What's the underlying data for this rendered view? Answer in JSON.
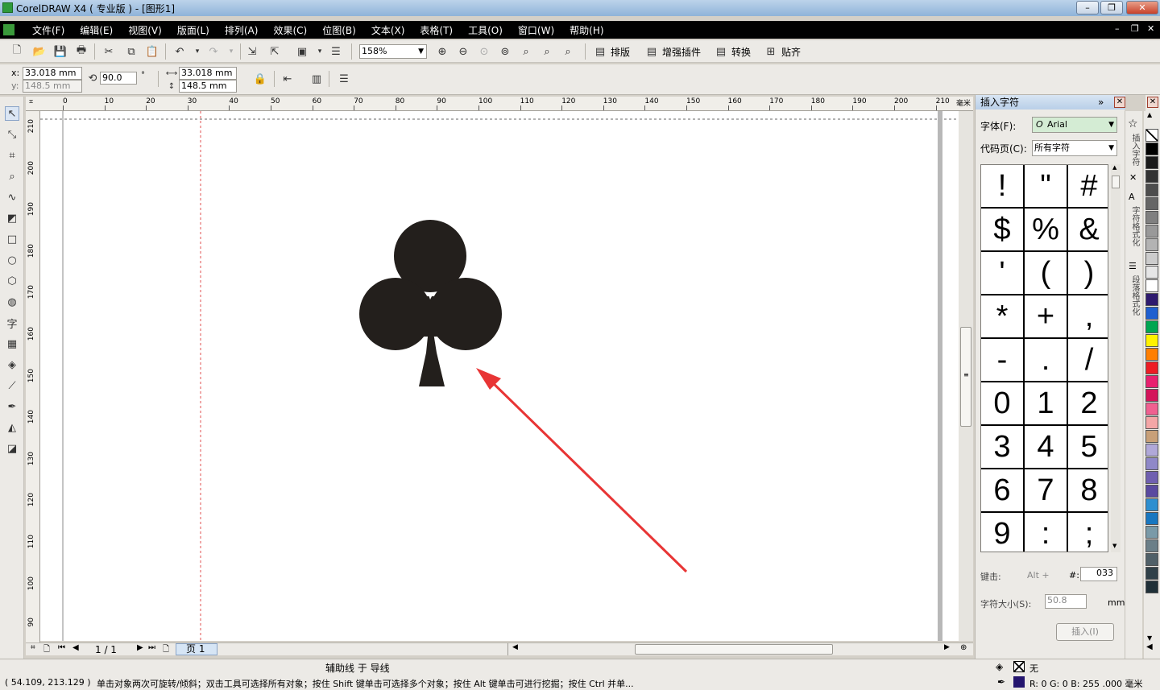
{
  "titlebar": {
    "title": "CorelDRAW X4 ( 专业版 ) - [图形1]"
  },
  "menu": [
    "文件(F)",
    "编辑(E)",
    "视图(V)",
    "版面(L)",
    "排列(A)",
    "效果(C)",
    "位图(B)",
    "文本(X)",
    "表格(T)",
    "工具(O)",
    "窗口(W)",
    "帮助(H)"
  ],
  "toolbar": {
    "zoom": "158%",
    "btn_layout": "排版",
    "btn_plugin": "增强插件",
    "btn_convert": "转换",
    "btn_snap": "贴齐"
  },
  "propbar": {
    "x_label": "x:",
    "x": "33.018 mm",
    "y_label": "y:",
    "y": "148.5 mm",
    "angle": "90.0",
    "deg": "°",
    "w": "33.018 mm",
    "h": "148.5 mm"
  },
  "ruler": {
    "top": [
      "0",
      "10",
      "20",
      "30",
      "40",
      "50",
      "60",
      "70",
      "80",
      "90",
      "100",
      "110",
      "120",
      "130",
      "140",
      "150",
      "160",
      "170",
      "180",
      "190",
      "200",
      "210"
    ],
    "unit": "毫米",
    "left": [
      "210",
      "200",
      "190",
      "180",
      "170",
      "160",
      "150",
      "140",
      "130",
      "120",
      "110",
      "100",
      "90"
    ]
  },
  "bottom": {
    "page_count": "1 / 1",
    "page_tab": "页 1"
  },
  "status": {
    "coords": "( 54.109, 213.129 )",
    "hint_top": "辅助线 于 导线",
    "hint": "单击对象两次可旋转/倾斜；双击工具可选择所有对象；按住 Shift 键单击可选择多个对象；按住 Alt 键单击可进行挖掘；按住 Ctrl 并单...",
    "fill": "无",
    "outline": "R: 0 G: 0 B: 255 .000 毫米"
  },
  "docker": {
    "title": "插入字符",
    "font_label": "字体(F):",
    "font": "Arial",
    "codepage_label": "代码页(C):",
    "codepage": "所有字符",
    "glyphs": [
      "!",
      "\"",
      "#",
      "$",
      "%",
      "&",
      "'",
      "(",
      ")",
      "*",
      "+",
      ",",
      "-",
      ".",
      "/",
      "0",
      "1",
      "2",
      "3",
      "4",
      "5",
      "6",
      "7",
      "8",
      "9",
      ":",
      ";"
    ],
    "key_label": "键击:",
    "alt_label": "Alt +",
    "hash_label": "#:",
    "code": "033",
    "size_label": "字符大小(S):",
    "size": "50.8",
    "unit": "mm",
    "insert": "插入(I)"
  },
  "sidetabs": [
    "插入字符",
    "字符格式化",
    "段落格式化"
  ],
  "palette": [
    "#ffffff",
    "#000000",
    "#1a1a1a",
    "#333333",
    "#4d4d4d",
    "#666666",
    "#808080",
    "#999999",
    "#b3b3b3",
    "#cccccc",
    "#e6e6e6",
    "#ffffff",
    "#2e1a6e",
    "#1e5fd0",
    "#00a651",
    "#fff200",
    "#ff7f00",
    "#ed1c24",
    "#e8206e",
    "#d4145a",
    "#f06090",
    "#f4a6a6",
    "#c8a078",
    "#b0a8d8",
    "#8f88c8",
    "#7060b0",
    "#5a4aa0",
    "#2d8fd0",
    "#1877c0",
    "#7a9aa8",
    "#6b7f88",
    "#506068",
    "#304048",
    "#203038"
  ]
}
